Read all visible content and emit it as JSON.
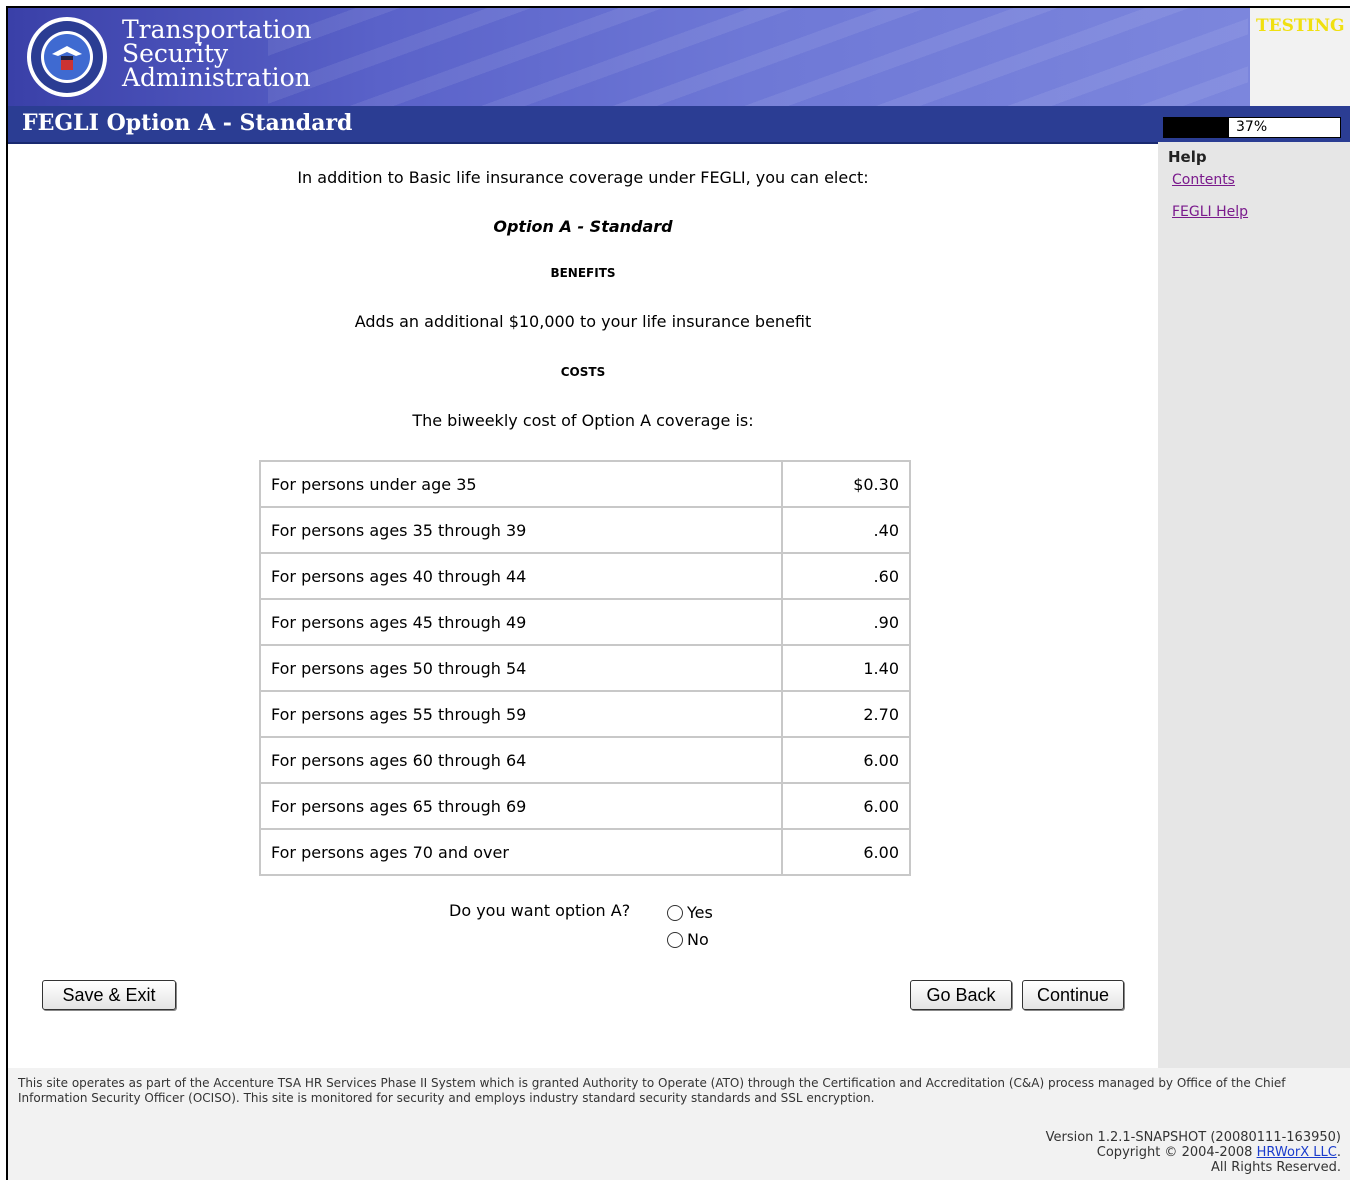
{
  "banner": {
    "agency_line1": "Transportation",
    "agency_line2": "Security",
    "agency_line3": "Administration",
    "env_label": "TESTING"
  },
  "page_title": "FEGLI Option A - Standard",
  "progress": {
    "percent": 37,
    "label": "37%"
  },
  "help": {
    "heading": "Help",
    "links": [
      "Contents",
      "FEGLI Help"
    ]
  },
  "content": {
    "intro": "In addition to Basic life insurance coverage under FEGLI, you can elect:",
    "option_name": "Option A - Standard",
    "benefits_heading": "BENEFITS",
    "benefits_text": "Adds an additional $10,000 to your life insurance benefit",
    "costs_heading": "COSTS",
    "costs_text": "The biweekly cost of Option A coverage is:"
  },
  "rates": [
    {
      "label": "For persons under age 35",
      "value": "$0.30"
    },
    {
      "label": "For persons ages 35 through 39",
      "value": ".40"
    },
    {
      "label": "For persons ages 40 through 44",
      "value": ".60"
    },
    {
      "label": "For persons ages 45 through 49",
      "value": ".90"
    },
    {
      "label": "For persons ages 50 through 54",
      "value": "1.40"
    },
    {
      "label": "For persons ages 55 through 59",
      "value": "2.70"
    },
    {
      "label": "For persons ages 60 through 64",
      "value": "6.00"
    },
    {
      "label": "For persons ages 65 through 69",
      "value": "6.00"
    },
    {
      "label": "For persons ages 70 and over",
      "value": "6.00"
    }
  ],
  "question": {
    "text": "Do you want option A?",
    "yes_label": "Yes",
    "no_label": "No"
  },
  "buttons": {
    "save_exit": "Save & Exit",
    "go_back": "Go Back",
    "continue": "Continue"
  },
  "footer": {
    "disclaimer": "This site operates as part of the Accenture TSA HR Services Phase II System which is granted Authority to Operate (ATO) through the Certification and Accreditation (C&A) process managed by Office of the Chief Information Security Officer (OCISO). This site is monitored for security and employs industry standard security standards and SSL encryption.",
    "version": "Version 1.2.1-SNAPSHOT (20080111-163950)",
    "copyright_prefix": "Copyright © 2004-2008",
    "company_link": "HRWorX LLC",
    "rights": "All Rights Reserved."
  },
  "colors": {
    "title_bar": "#2b3d93",
    "link_visited": "#7a1a8c",
    "testing": "#f0e010"
  }
}
